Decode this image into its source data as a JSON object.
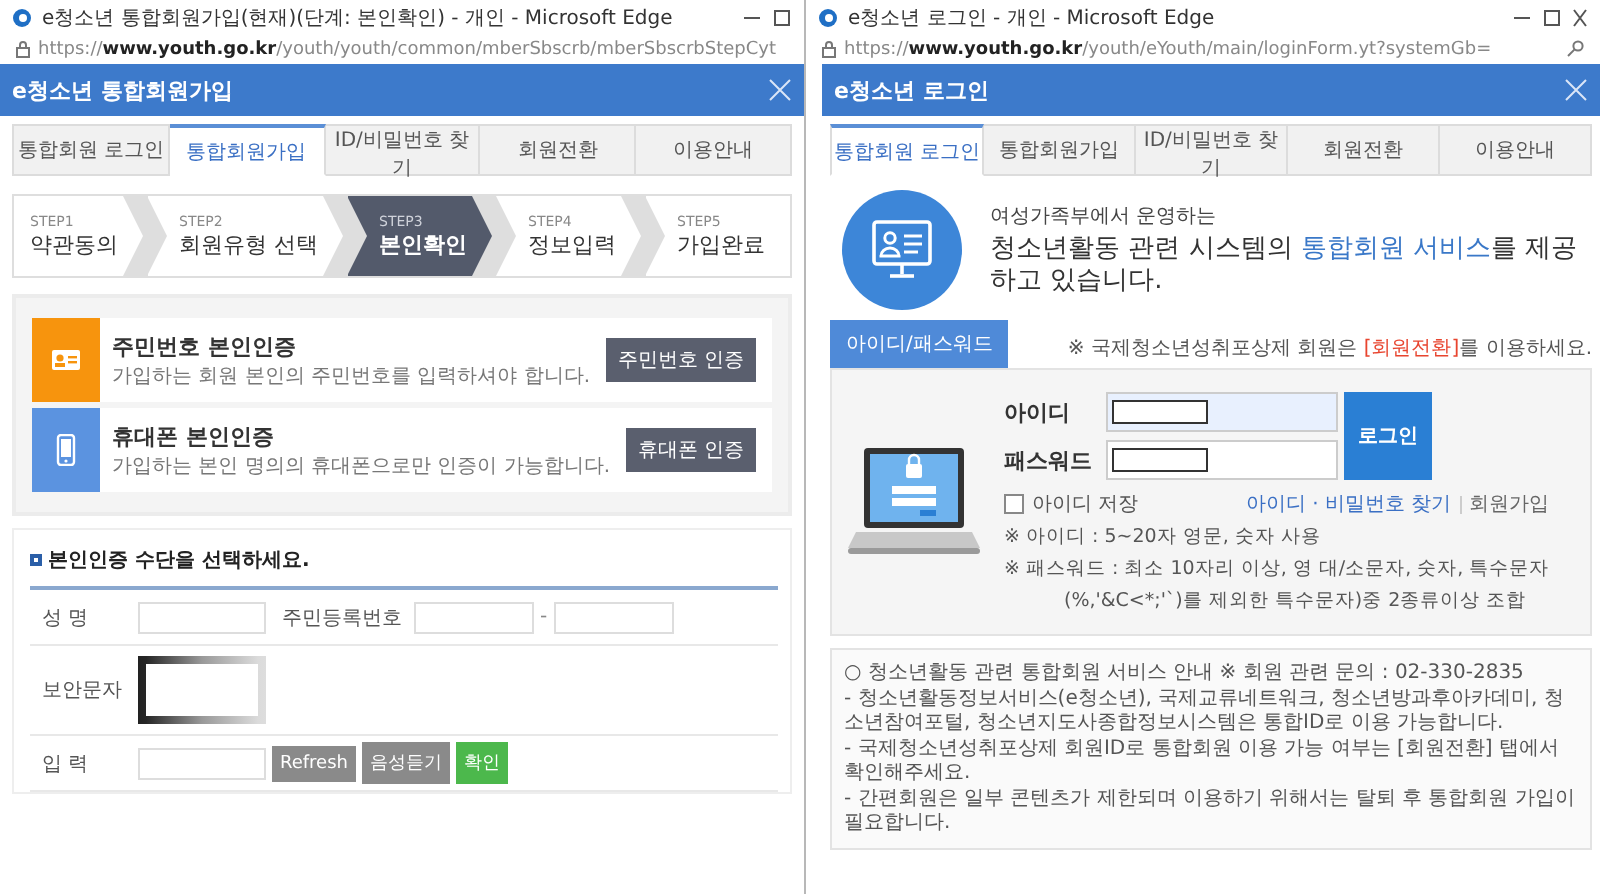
{
  "left_window": {
    "title": "e청소년 통합회원가입(현재)(단계: 본인확인) - 개인 - Microsoft Edge",
    "url": {
      "scheme": "https://",
      "host": "www.youth.go.kr",
      "path": "/youth/youth/common/mberSbscrb/mberSbscrbStepCyt"
    },
    "header": "e청소년 통합회원가입",
    "tabs": [
      {
        "label": "통합회원 로그인",
        "selected": false
      },
      {
        "label": "통합회원가입",
        "selected": true
      },
      {
        "label": "ID/비밀번호 찾기",
        "selected": false
      },
      {
        "label": "회원전환",
        "selected": false
      },
      {
        "label": "이용안내",
        "selected": false
      }
    ],
    "steps": [
      {
        "step": "STEP1",
        "label": "약관동의",
        "selected": false
      },
      {
        "step": "STEP2",
        "label": "회원유형 선택",
        "selected": false
      },
      {
        "step": "STEP3",
        "label": "본인확인",
        "selected": true
      },
      {
        "step": "STEP4",
        "label": "정보입력",
        "selected": false
      },
      {
        "step": "STEP5",
        "label": "가입완료",
        "selected": false
      }
    ],
    "methods": [
      {
        "kind": "resident",
        "title": "주민번호 본인인증",
        "description": "가입하는 회원 본인의 주민번호를 입력하셔야 합니다.",
        "button": "주민번호 인증"
      },
      {
        "kind": "phone",
        "title": "휴대폰 본인인증",
        "description": "가입하는 본인 명의의 휴대폰으로만 인증이 가능합니다.",
        "button": "휴대폰 인증"
      }
    ],
    "form": {
      "heading": "본인인증 수단을 선택하세요.",
      "name_label": "성 명",
      "rrn_label": "주민등록번호",
      "rrn_separator": "-",
      "captcha_label": "보안문자",
      "input_label": "입 력",
      "buttons": [
        {
          "kind": "refresh",
          "label": "Refresh"
        },
        {
          "kind": "audio",
          "label": "음성듣기"
        },
        {
          "kind": "confirm",
          "label": "확인"
        }
      ]
    }
  },
  "right_window": {
    "title": "e청소년 로그인 - 개인 - Microsoft Edge",
    "url": {
      "scheme": "https://",
      "host": "www.youth.go.kr",
      "path": "/youth/eYouth/main/loginForm.yt?systemGb="
    },
    "header": "e청소년 로그인",
    "tabs": [
      {
        "label": "통합회원 로그인",
        "selected": true
      },
      {
        "label": "통합회원가입",
        "selected": false
      },
      {
        "label": "ID/비밀번호 찾기",
        "selected": false
      },
      {
        "label": "회원전환",
        "selected": false
      },
      {
        "label": "이용안내",
        "selected": false
      }
    ],
    "intro": {
      "line1": "여성가족부에서 운영하는",
      "line2": {
        "before": "청소년활동 관련 시스템의 ",
        "highlight": "통합회원 서비스",
        "after": "를 제공하고 있습니다."
      }
    },
    "login": {
      "tab": "아이디/패스워드",
      "notice": {
        "before": "※ 국제청소년성취포상제 회원은 ",
        "highlight": "[회원전환]",
        "after": "를 이용하세요."
      },
      "id_label": "아이디",
      "password_label": "패스워드",
      "button": "로그인",
      "remember": {
        "label": "아이디 저장",
        "checked": false
      },
      "links": [
        {
          "label": "아이디 · 비밀번호 찾기",
          "color": "#3a6fc4"
        },
        {
          "label": "회원가입",
          "color": "#666666"
        }
      ],
      "rules": [
        {
          "kind": "rule",
          "text": "※ 아이디 : 5~20자 영문, 숫자 사용"
        },
        {
          "kind": "rule",
          "text": "※ 패스워드 : 최소 10자리 이상, 영 대/소문자, 숫자, 특수문자"
        },
        {
          "kind": "continuation",
          "text": "(%,'&C<*;'`)를 제외한 특수문자)중 2종류이상 조합"
        }
      ]
    },
    "info": {
      "heading": "○ 청소년활동 관련 통합회원 서비스 안내 ※ 회원 관련 문의 : 02-330-2835",
      "lines": [
        "- 청소년활동정보서비스(e청소년), 국제교류네트워크, 청소년방과후아카데미, 청소년참여포털, 청소년지도사종합정보시스템은 통합ID로 이용 가능합니다.",
        "- 국제청소년성취포상제 회원ID로 통합회원 이용 가능 여부는 [회원전환] 탭에서 확인해주세요.",
        "- 간편회원은 일부 콘텐츠가 제한되며 이용하기 위해서는 탈퇴 후 통합회원 가입이 필요합니다."
      ]
    }
  }
}
